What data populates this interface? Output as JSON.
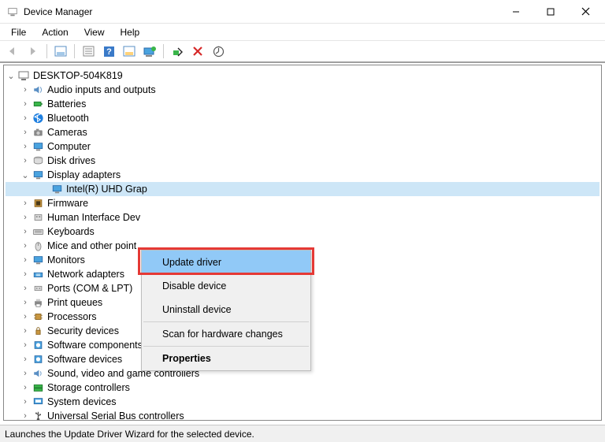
{
  "window": {
    "title": "Device Manager"
  },
  "menu": {
    "file": "File",
    "action": "Action",
    "view": "View",
    "help": "Help"
  },
  "root": {
    "label": "DESKTOP-504K819"
  },
  "categories": [
    {
      "label": "Audio inputs and outputs",
      "icon": "speaker"
    },
    {
      "label": "Batteries",
      "icon": "battery"
    },
    {
      "label": "Bluetooth",
      "icon": "bluetooth"
    },
    {
      "label": "Cameras",
      "icon": "camera"
    },
    {
      "label": "Computer",
      "icon": "computer"
    },
    {
      "label": "Disk drives",
      "icon": "disk"
    },
    {
      "label": "Display adapters",
      "icon": "display",
      "expanded": true
    },
    {
      "label": "Firmware",
      "icon": "firmware"
    },
    {
      "label": "Human Interface Dev",
      "icon": "hid",
      "truncated": true
    },
    {
      "label": "Keyboards",
      "icon": "keyboard"
    },
    {
      "label": "Mice and other point",
      "icon": "mouse",
      "truncated": true
    },
    {
      "label": "Monitors",
      "icon": "display"
    },
    {
      "label": "Network adapters",
      "icon": "network"
    },
    {
      "label": "Ports (COM & LPT)",
      "icon": "port"
    },
    {
      "label": "Print queues",
      "icon": "printer"
    },
    {
      "label": "Processors",
      "icon": "cpu"
    },
    {
      "label": "Security devices",
      "icon": "security"
    },
    {
      "label": "Software components",
      "icon": "software"
    },
    {
      "label": "Software devices",
      "icon": "software"
    },
    {
      "label": "Sound, video and game controllers",
      "icon": "sound"
    },
    {
      "label": "Storage controllers",
      "icon": "storage"
    },
    {
      "label": "System devices",
      "icon": "system"
    },
    {
      "label": "Universal Serial Bus controllers",
      "icon": "usb"
    }
  ],
  "selected_device": {
    "label": "Intel(R) UHD Grap"
  },
  "context_menu": {
    "update": "Update driver",
    "disable": "Disable device",
    "uninstall": "Uninstall device",
    "scan": "Scan for hardware changes",
    "properties": "Properties"
  },
  "status_text": "Launches the Update Driver Wizard for the selected device."
}
